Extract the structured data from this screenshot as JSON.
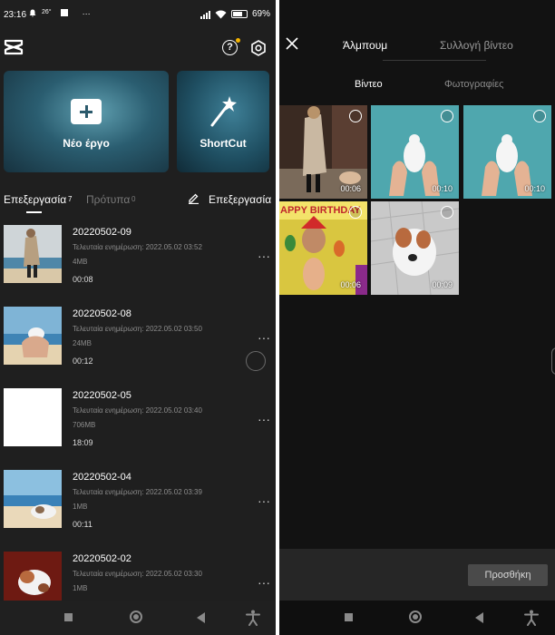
{
  "status_bar": {
    "time": "23:16",
    "notif_icons": [
      "bell-icon",
      "temperature-icon",
      "square-icon",
      "more-icon"
    ],
    "temperature": "26°",
    "more": "···",
    "battery": "69"
  },
  "left": {
    "cards": {
      "new_project": "Νέο έργο",
      "shortcut": "ShortCut"
    },
    "tabs": {
      "editing": "Επεξεργασία",
      "editing_count": "7",
      "templates": "Πρότυπα",
      "templates_count": "0",
      "edit_action": "Επεξεργασία"
    },
    "projects": [
      {
        "name": "20220502-09",
        "updated": "Τελευταία ενημέρωση: 2022.05.02 03:52",
        "size": "4MB",
        "duration": "00:08"
      },
      {
        "name": "20220502-08",
        "updated": "Τελευταία ενημέρωση: 2022.05.02 03:50",
        "size": "24MB",
        "duration": "00:12"
      },
      {
        "name": "20220502-05",
        "updated": "Τελευταία ενημέρωση: 2022.05.02 03:40",
        "size": "706MB",
        "duration": "18:09"
      },
      {
        "name": "20220502-04",
        "updated": "Τελευταία ενημέρωση: 2022.05.02 03:39",
        "size": "1MB",
        "duration": "00:11"
      },
      {
        "name": "20220502-02",
        "updated": "Τελευταία ενημέρωση: 2022.05.02 03:30",
        "size": "1MB",
        "duration": ""
      }
    ],
    "more": "···"
  },
  "right": {
    "tabs": {
      "album": "Άλμπουμ",
      "video_collection": "Συλλογή βίντεο"
    },
    "subtabs": {
      "videos": "Βίντεο",
      "photos": "Φωτογραφίες"
    },
    "media": [
      {
        "duration": "00:06",
        "kind": "woman-in-coat"
      },
      {
        "duration": "00:10",
        "kind": "dove-hands"
      },
      {
        "duration": "00:10",
        "kind": "dove-hands"
      },
      {
        "duration": "00:06",
        "kind": "happy-birthday",
        "text": "APPY BIRTHDAY"
      },
      {
        "duration": "00:09",
        "kind": "dog"
      }
    ],
    "add_button": "Προσθήκη"
  },
  "colors": {
    "panel_left": "#1f1f1f",
    "panel_right": "#121212",
    "accent_dot": "#f5b400"
  }
}
